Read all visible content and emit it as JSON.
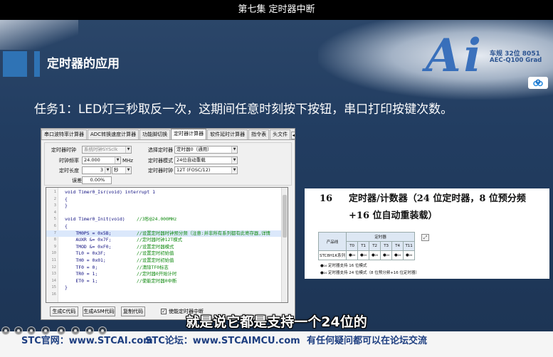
{
  "video": {
    "title": "第七集 定时器中断"
  },
  "slide": {
    "section_title": "定时器的应用",
    "logo": {
      "mark": "Ai",
      "line1": "车规 32位 8051",
      "line2": "AEC-Q100 Grad"
    },
    "task": "任务1：LED灯三秒取反一次，这期间任意时刻按下按钮，串口打印按键次数。"
  },
  "tool": {
    "tabs": [
      "串口波特率计算器",
      "ADC转换速度计算器",
      "功能脚切换",
      "定时器计算器",
      "软件延时计算器",
      "指令表",
      "头文件"
    ],
    "active_tab": "定时器计算器",
    "tab_arrows": [
      "◀",
      "▶"
    ],
    "form": {
      "timer_clock_source": {
        "label": "定时器时钟",
        "value": "系统时钟SYSclk"
      },
      "clock_freq": {
        "label": "时钟频率",
        "value": "24.000",
        "unit": "MHz"
      },
      "duration": {
        "label": "定时长度",
        "value": "3",
        "unit": "秒"
      },
      "error": {
        "label": "误差",
        "value": "0.00%"
      },
      "select_timer": {
        "label": "选择定时器",
        "value": "定时器0（通用）"
      },
      "timer_mode": {
        "label": "定时器模式",
        "value": "24位自动重载"
      },
      "timer_clock": {
        "label": "定时器时钟",
        "value": "12T (FOSC/12)"
      }
    },
    "code": {
      "highlighted_line": "7",
      "lines": [
        {
          "n": "1",
          "code": "void Timer0_Isr(void) interrupt 1",
          "comment": ""
        },
        {
          "n": "2",
          "code": "{",
          "comment": ""
        },
        {
          "n": "3",
          "code": "}",
          "comment": ""
        },
        {
          "n": "4",
          "code": "",
          "comment": ""
        },
        {
          "n": "5",
          "code": "void Timer0_Init(void)",
          "comment": "//3秒@24.000MHz"
        },
        {
          "n": "6",
          "code": "{",
          "comment": ""
        },
        {
          "n": "7",
          "code": "    TM0PS = 0x5B;",
          "comment": "//设置定时器时钟预分频（注意:并非所有系列都有此寄存器,详情"
        },
        {
          "n": "8",
          "code": "    AUXR &= 0x7F;",
          "comment": "//定时器时钟12T模式"
        },
        {
          "n": "9",
          "code": "    TMOD &= 0xF0;",
          "comment": "//设置定时器模式"
        },
        {
          "n": "10",
          "code": "    TL0 = 0x3F;",
          "comment": "//设置定时初始值"
        },
        {
          "n": "11",
          "code": "    TH0 = 0x01;",
          "comment": "//设置定时初始值"
        },
        {
          "n": "12",
          "code": "    TF0 = 0;",
          "comment": "//清除TF0标志"
        },
        {
          "n": "13",
          "code": "    TR0 = 1;",
          "comment": "//定时器0开始计时"
        },
        {
          "n": "14",
          "code": "    ET0 = 1;",
          "comment": "//使能定时器0中断"
        },
        {
          "n": "15",
          "code": "}",
          "comment": ""
        },
        {
          "n": "16",
          "code": "",
          "comment": ""
        }
      ]
    },
    "buttons": {
      "gen_c": "生成C代码",
      "gen_asm": "生成ASM代码",
      "copy": "复制代码"
    },
    "checkbox": {
      "label": "使能定时器中断",
      "checked": true,
      "mark": "✓"
    }
  },
  "datasheet": {
    "number": "16",
    "title_line1": "定时器/计数器（24 位定时器，8 位预分频",
    "title_line2": "+16 位自动重装载）",
    "table": {
      "product_header": "产品线",
      "timer_header": "定时器",
      "columns": [
        "T0",
        "T1",
        "T2",
        "T3",
        "T4",
        "T11"
      ],
      "row": {
        "label": "STC8H1K系列",
        "cells": [
          "●₂₄",
          "●₂₄",
          "●₂₄",
          "●₂₄",
          "●₂₄",
          "●₂₄"
        ]
      }
    },
    "footnotes": [
      "●₁₆ 定时器支持 16 位模式",
      "●₂₄ 定时器支持 24 位模式（8 位预分频+16 位定时器）"
    ]
  },
  "subtitle": "就是说它都是支持一个24位的",
  "footer": {
    "site": "STC官网：www.STCAI.com",
    "forum": "STC论坛：www.STCAIMCU.com",
    "note": "有任何疑问都可以在论坛交流"
  },
  "icons": {
    "side_button": "cloud-icon",
    "table_expand": "expand-icon",
    "player_controls": "player-control-icon"
  },
  "colors": {
    "slide_background": "#213c5f",
    "accent_blue": "#2f73b5",
    "logo_blue": "#2b66b8",
    "footer_text": "#1d3e80",
    "code_text": "#101080",
    "code_comment": "#108a10"
  }
}
